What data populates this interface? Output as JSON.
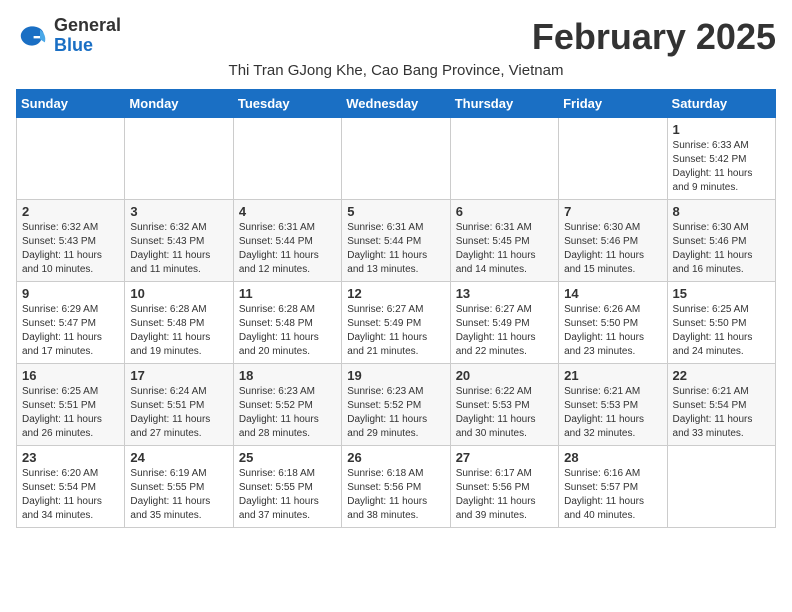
{
  "header": {
    "logo_general": "General",
    "logo_blue": "Blue",
    "month_title": "February 2025",
    "subtitle": "Thi Tran GJong Khe, Cao Bang Province, Vietnam"
  },
  "days_of_week": [
    "Sunday",
    "Monday",
    "Tuesday",
    "Wednesday",
    "Thursday",
    "Friday",
    "Saturday"
  ],
  "weeks": [
    [
      {
        "day": "",
        "info": ""
      },
      {
        "day": "",
        "info": ""
      },
      {
        "day": "",
        "info": ""
      },
      {
        "day": "",
        "info": ""
      },
      {
        "day": "",
        "info": ""
      },
      {
        "day": "",
        "info": ""
      },
      {
        "day": "1",
        "info": "Sunrise: 6:33 AM\nSunset: 5:42 PM\nDaylight: 11 hours and 9 minutes."
      }
    ],
    [
      {
        "day": "2",
        "info": "Sunrise: 6:32 AM\nSunset: 5:43 PM\nDaylight: 11 hours and 10 minutes."
      },
      {
        "day": "3",
        "info": "Sunrise: 6:32 AM\nSunset: 5:43 PM\nDaylight: 11 hours and 11 minutes."
      },
      {
        "day": "4",
        "info": "Sunrise: 6:31 AM\nSunset: 5:44 PM\nDaylight: 11 hours and 12 minutes."
      },
      {
        "day": "5",
        "info": "Sunrise: 6:31 AM\nSunset: 5:44 PM\nDaylight: 11 hours and 13 minutes."
      },
      {
        "day": "6",
        "info": "Sunrise: 6:31 AM\nSunset: 5:45 PM\nDaylight: 11 hours and 14 minutes."
      },
      {
        "day": "7",
        "info": "Sunrise: 6:30 AM\nSunset: 5:46 PM\nDaylight: 11 hours and 15 minutes."
      },
      {
        "day": "8",
        "info": "Sunrise: 6:30 AM\nSunset: 5:46 PM\nDaylight: 11 hours and 16 minutes."
      }
    ],
    [
      {
        "day": "9",
        "info": "Sunrise: 6:29 AM\nSunset: 5:47 PM\nDaylight: 11 hours and 17 minutes."
      },
      {
        "day": "10",
        "info": "Sunrise: 6:28 AM\nSunset: 5:48 PM\nDaylight: 11 hours and 19 minutes."
      },
      {
        "day": "11",
        "info": "Sunrise: 6:28 AM\nSunset: 5:48 PM\nDaylight: 11 hours and 20 minutes."
      },
      {
        "day": "12",
        "info": "Sunrise: 6:27 AM\nSunset: 5:49 PM\nDaylight: 11 hours and 21 minutes."
      },
      {
        "day": "13",
        "info": "Sunrise: 6:27 AM\nSunset: 5:49 PM\nDaylight: 11 hours and 22 minutes."
      },
      {
        "day": "14",
        "info": "Sunrise: 6:26 AM\nSunset: 5:50 PM\nDaylight: 11 hours and 23 minutes."
      },
      {
        "day": "15",
        "info": "Sunrise: 6:25 AM\nSunset: 5:50 PM\nDaylight: 11 hours and 24 minutes."
      }
    ],
    [
      {
        "day": "16",
        "info": "Sunrise: 6:25 AM\nSunset: 5:51 PM\nDaylight: 11 hours and 26 minutes."
      },
      {
        "day": "17",
        "info": "Sunrise: 6:24 AM\nSunset: 5:51 PM\nDaylight: 11 hours and 27 minutes."
      },
      {
        "day": "18",
        "info": "Sunrise: 6:23 AM\nSunset: 5:52 PM\nDaylight: 11 hours and 28 minutes."
      },
      {
        "day": "19",
        "info": "Sunrise: 6:23 AM\nSunset: 5:52 PM\nDaylight: 11 hours and 29 minutes."
      },
      {
        "day": "20",
        "info": "Sunrise: 6:22 AM\nSunset: 5:53 PM\nDaylight: 11 hours and 30 minutes."
      },
      {
        "day": "21",
        "info": "Sunrise: 6:21 AM\nSunset: 5:53 PM\nDaylight: 11 hours and 32 minutes."
      },
      {
        "day": "22",
        "info": "Sunrise: 6:21 AM\nSunset: 5:54 PM\nDaylight: 11 hours and 33 minutes."
      }
    ],
    [
      {
        "day": "23",
        "info": "Sunrise: 6:20 AM\nSunset: 5:54 PM\nDaylight: 11 hours and 34 minutes."
      },
      {
        "day": "24",
        "info": "Sunrise: 6:19 AM\nSunset: 5:55 PM\nDaylight: 11 hours and 35 minutes."
      },
      {
        "day": "25",
        "info": "Sunrise: 6:18 AM\nSunset: 5:55 PM\nDaylight: 11 hours and 37 minutes."
      },
      {
        "day": "26",
        "info": "Sunrise: 6:18 AM\nSunset: 5:56 PM\nDaylight: 11 hours and 38 minutes."
      },
      {
        "day": "27",
        "info": "Sunrise: 6:17 AM\nSunset: 5:56 PM\nDaylight: 11 hours and 39 minutes."
      },
      {
        "day": "28",
        "info": "Sunrise: 6:16 AM\nSunset: 5:57 PM\nDaylight: 11 hours and 40 minutes."
      },
      {
        "day": "",
        "info": ""
      }
    ]
  ]
}
